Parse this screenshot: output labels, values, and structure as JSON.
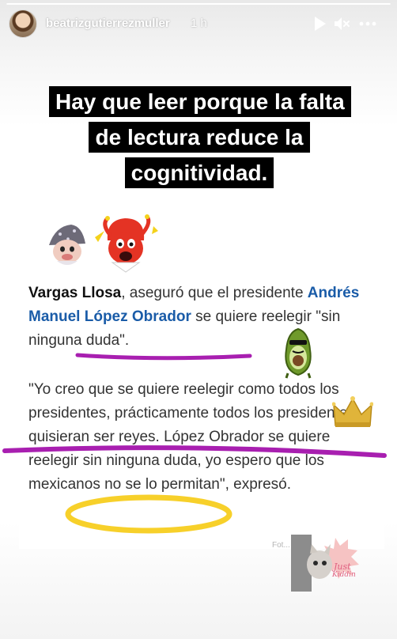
{
  "story": {
    "username": "beatrizgutierrezmuller",
    "time": "1 h",
    "progress_fraction": 1.0
  },
  "headline": "Hay que leer porque la falta de lectura reduce la cognitividad.",
  "article": {
    "p1_name": "Vargas Llosa",
    "p1_text1": ", aseguró que el presidente ",
    "p1_link": "Andrés Manuel López Obrador",
    "p1_text2": " se quiere reelegir \"sin ninguna duda\".",
    "p2_text": "\"Yo creo que se quiere reelegir como todos los presidentes, prácticamente todos los presidentes quisieran ser reyes. López Obrador se quiere reelegir sin ninguna duda, yo espero que los mexicanos no se lo permitan\", expresó.",
    "caption_fragment": "Fot... ...ión"
  },
  "stickers": {
    "kiddin_label_1": "Just",
    "kiddin_label_2": "Kiddin"
  },
  "colors": {
    "underline": "#a81fb0",
    "ellipse": "#f7d02a",
    "link": "#1a5ca8"
  },
  "icons": [
    "play-icon",
    "mute-icon",
    "more-icon",
    "crown-icon",
    "avocado-icon",
    "jester-icon",
    "wizard-icon",
    "cat-icon"
  ]
}
